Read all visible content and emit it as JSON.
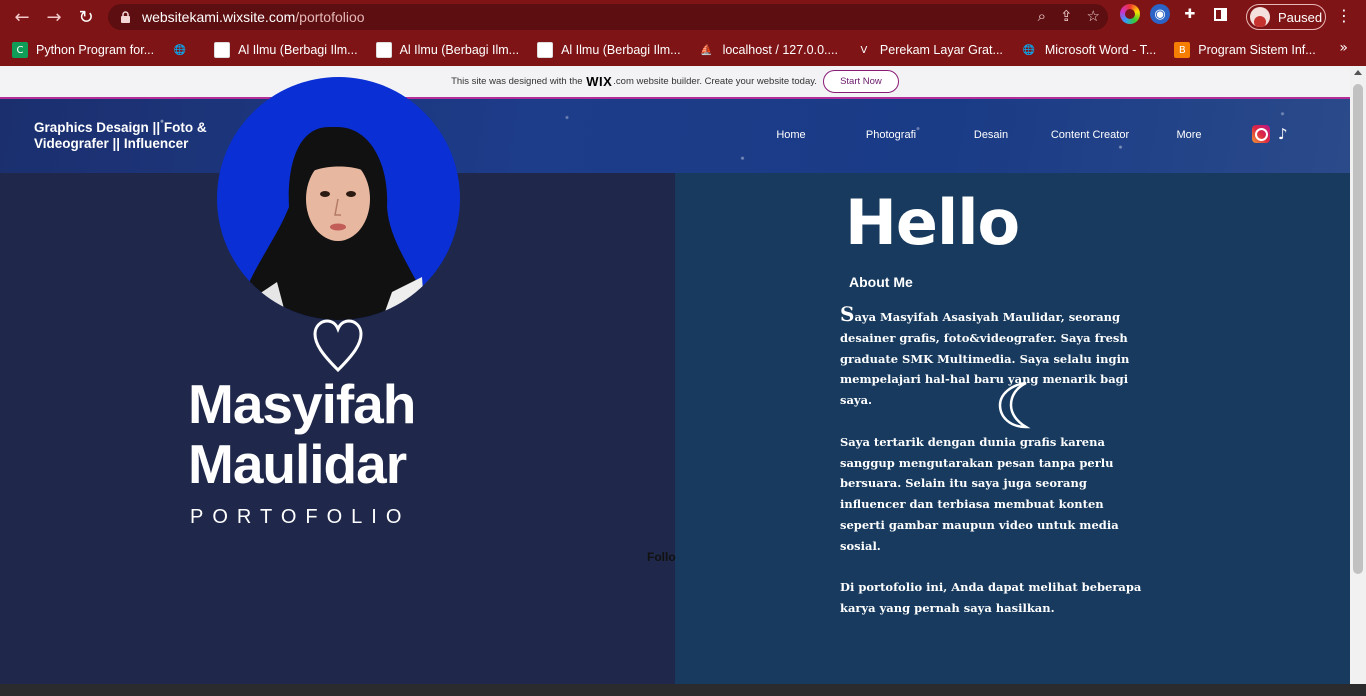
{
  "browser": {
    "url_host": "websitekami.wixsite.com",
    "url_path": "/portofolioo",
    "profile_label": "Paused",
    "bookmarks": [
      {
        "label": "Python Program for...",
        "icon": "python-icon",
        "color": "#0f9d58",
        "glyph": "C"
      },
      {
        "label": "",
        "icon": "globe-icon",
        "color": "transparent",
        "glyph": "🌐"
      },
      {
        "label": "Al Ilmu (Berbagi Ilm...",
        "icon": "page-icon",
        "color": "#ffffff",
        "glyph": ""
      },
      {
        "label": "Al Ilmu (Berbagi Ilm...",
        "icon": "page-icon",
        "color": "#ffffff",
        "glyph": ""
      },
      {
        "label": "Al Ilmu (Berbagi Ilm...",
        "icon": "page-icon",
        "color": "#ffffff",
        "glyph": ""
      },
      {
        "label": "localhost / 127.0.0....",
        "icon": "phpmyadmin-icon",
        "color": "transparent",
        "glyph": "⛵"
      },
      {
        "label": "Perekam Layar Grat...",
        "icon": "vmaker-icon",
        "color": "transparent",
        "glyph": "V"
      },
      {
        "label": "Microsoft Word - T...",
        "icon": "globe-icon",
        "color": "transparent",
        "glyph": "🌐"
      },
      {
        "label": "Program Sistem Inf...",
        "icon": "blogger-icon",
        "color": "#f57d00",
        "glyph": "B"
      }
    ]
  },
  "wix_banner": {
    "text_before": "This site was designed with the",
    "brand": "WIX",
    "text_after": ".com website builder. Create your website today.",
    "button": "Start Now"
  },
  "header": {
    "title": "Graphics Desaign || Foto & Videografer || Influencer",
    "nav": [
      "Home",
      "Photografi",
      "Desain",
      "Content Creator",
      "More"
    ]
  },
  "hero": {
    "name": "Masyifah Maulidar",
    "subtitle": "PORTOFOLIO",
    "follow": "Follo"
  },
  "about": {
    "hello": "Hello",
    "heading": "About Me",
    "drop_cap": "S",
    "p1": "aya Masyifah Asasiyah Maulidar, seorang desainer grafis, foto&videografer. Saya fresh graduate SMK Multimedia. Saya selalu ingin mempelajari hal-hal baru yang menarik bagi saya.",
    "p2": "Saya tertarik dengan dunia grafis karena sanggup mengutarakan pesan tanpa perlu bersuara. Selain itu saya juga seorang influencer dan terbiasa membuat konten seperti gambar maupun video untuk media sosial.",
    "p3": "Di portofolio ini, Anda dapat melihat beberapa karya yang pernah saya hasilkan."
  },
  "colors": {
    "browser_frame": "#7f1416",
    "left_panel": "#1f284a",
    "right_panel": "#173a5e",
    "photo_bg": "#0a2fd4"
  }
}
